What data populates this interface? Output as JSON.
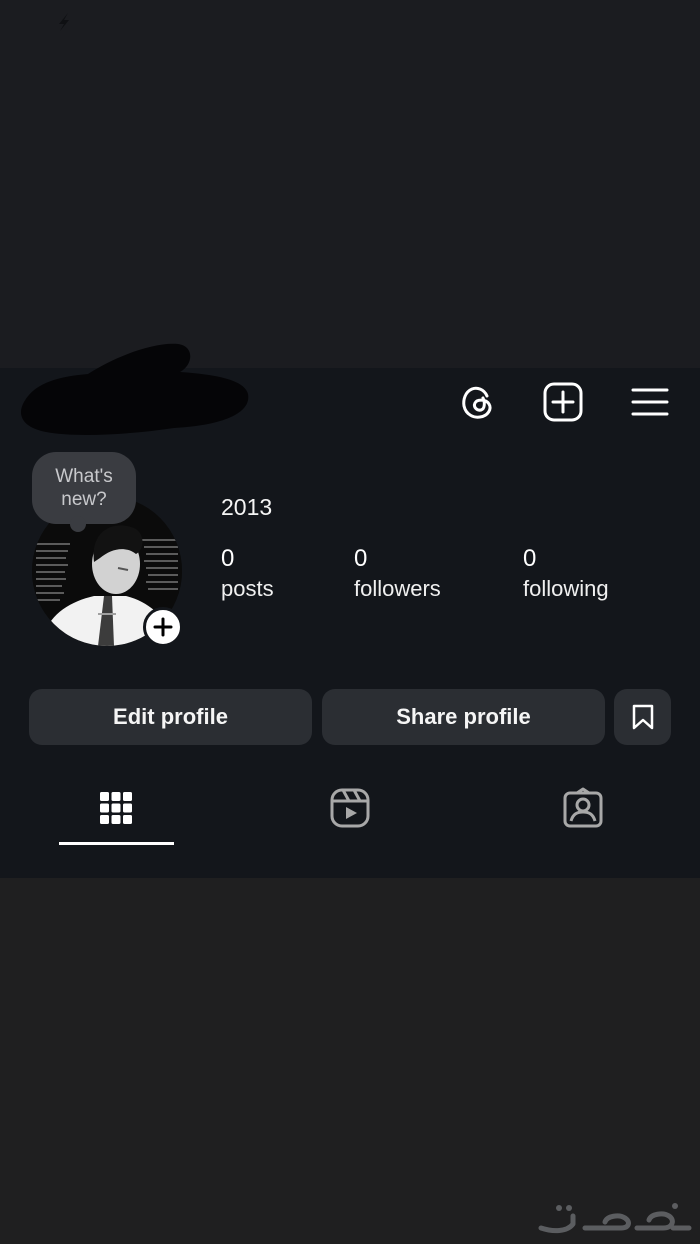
{
  "bubble": {
    "text": "What's\nnew?"
  },
  "profile": {
    "name": "2013",
    "stats": [
      {
        "value": "0",
        "label": "posts"
      },
      {
        "value": "0",
        "label": "followers"
      },
      {
        "value": "0",
        "label": "following"
      }
    ]
  },
  "buttons": {
    "edit": "Edit profile",
    "share": "Share profile"
  },
  "icons": {
    "header": [
      "threads-icon",
      "create-post-icon",
      "menu-icon"
    ],
    "tabs": [
      "grid-icon",
      "reels-icon",
      "tagged-icon"
    ],
    "save": "bookmark-icon",
    "avatar_add": "plus-icon"
  },
  "colors": {
    "background": "#13161b",
    "button": "#2b2e33",
    "text": "#f5f5f5",
    "bubble": "#3a3c41"
  }
}
